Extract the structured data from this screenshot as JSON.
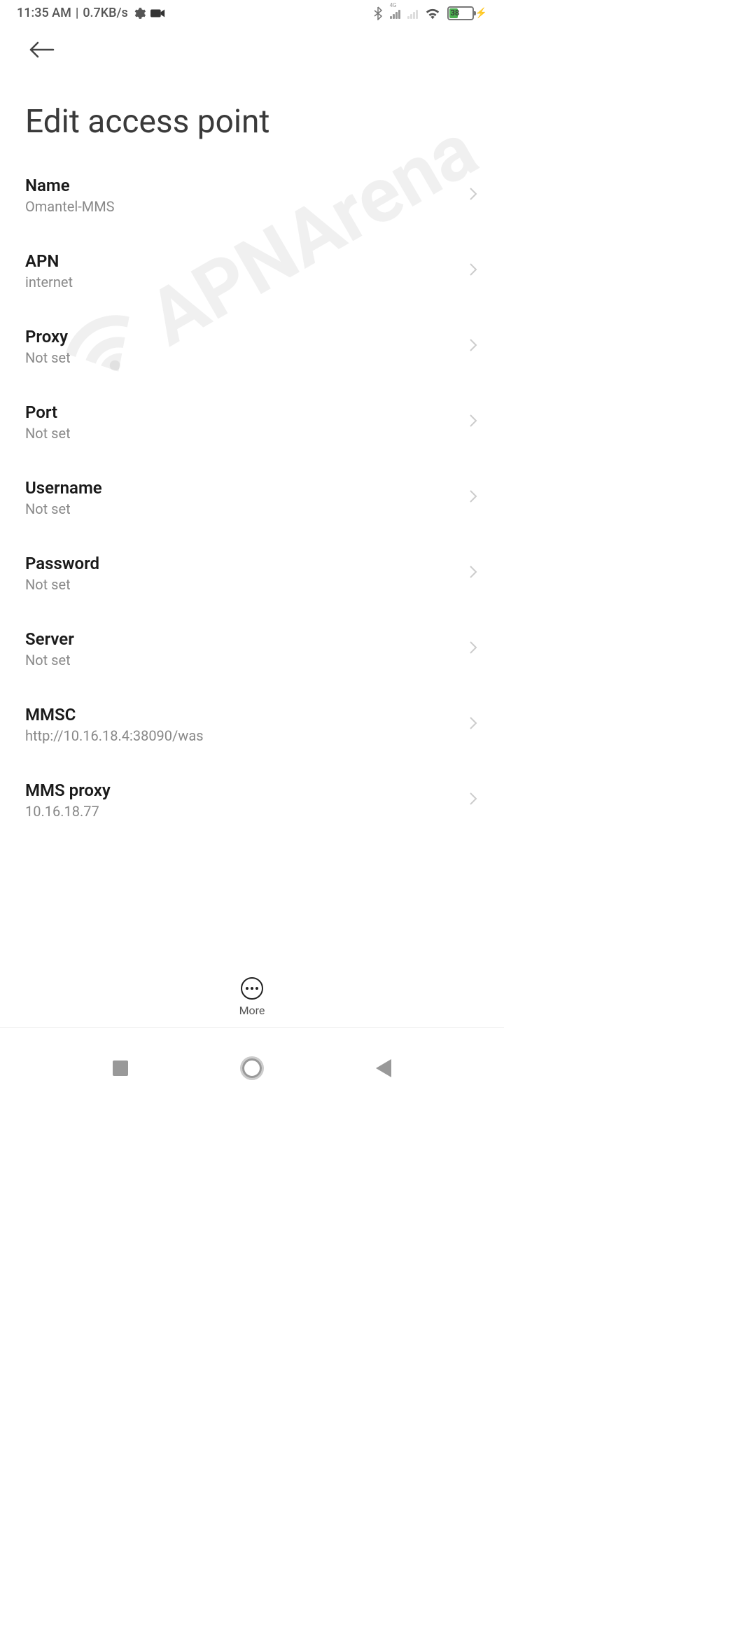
{
  "statusBar": {
    "time": "11:35 AM",
    "separator": "|",
    "dataRate": "0.7KB/s",
    "networkLabel": "4G",
    "batteryPercent": "38"
  },
  "header": {
    "pageTitle": "Edit access point"
  },
  "settings": [
    {
      "label": "Name",
      "value": "Omantel-MMS"
    },
    {
      "label": "APN",
      "value": "internet"
    },
    {
      "label": "Proxy",
      "value": "Not set"
    },
    {
      "label": "Port",
      "value": "Not set"
    },
    {
      "label": "Username",
      "value": "Not set"
    },
    {
      "label": "Password",
      "value": "Not set"
    },
    {
      "label": "Server",
      "value": "Not set"
    },
    {
      "label": "MMSC",
      "value": "http://10.16.18.4:38090/was"
    },
    {
      "label": "MMS proxy",
      "value": "10.16.18.77"
    }
  ],
  "bottomAction": {
    "moreLabel": "More"
  },
  "watermarkText": "APNArena"
}
